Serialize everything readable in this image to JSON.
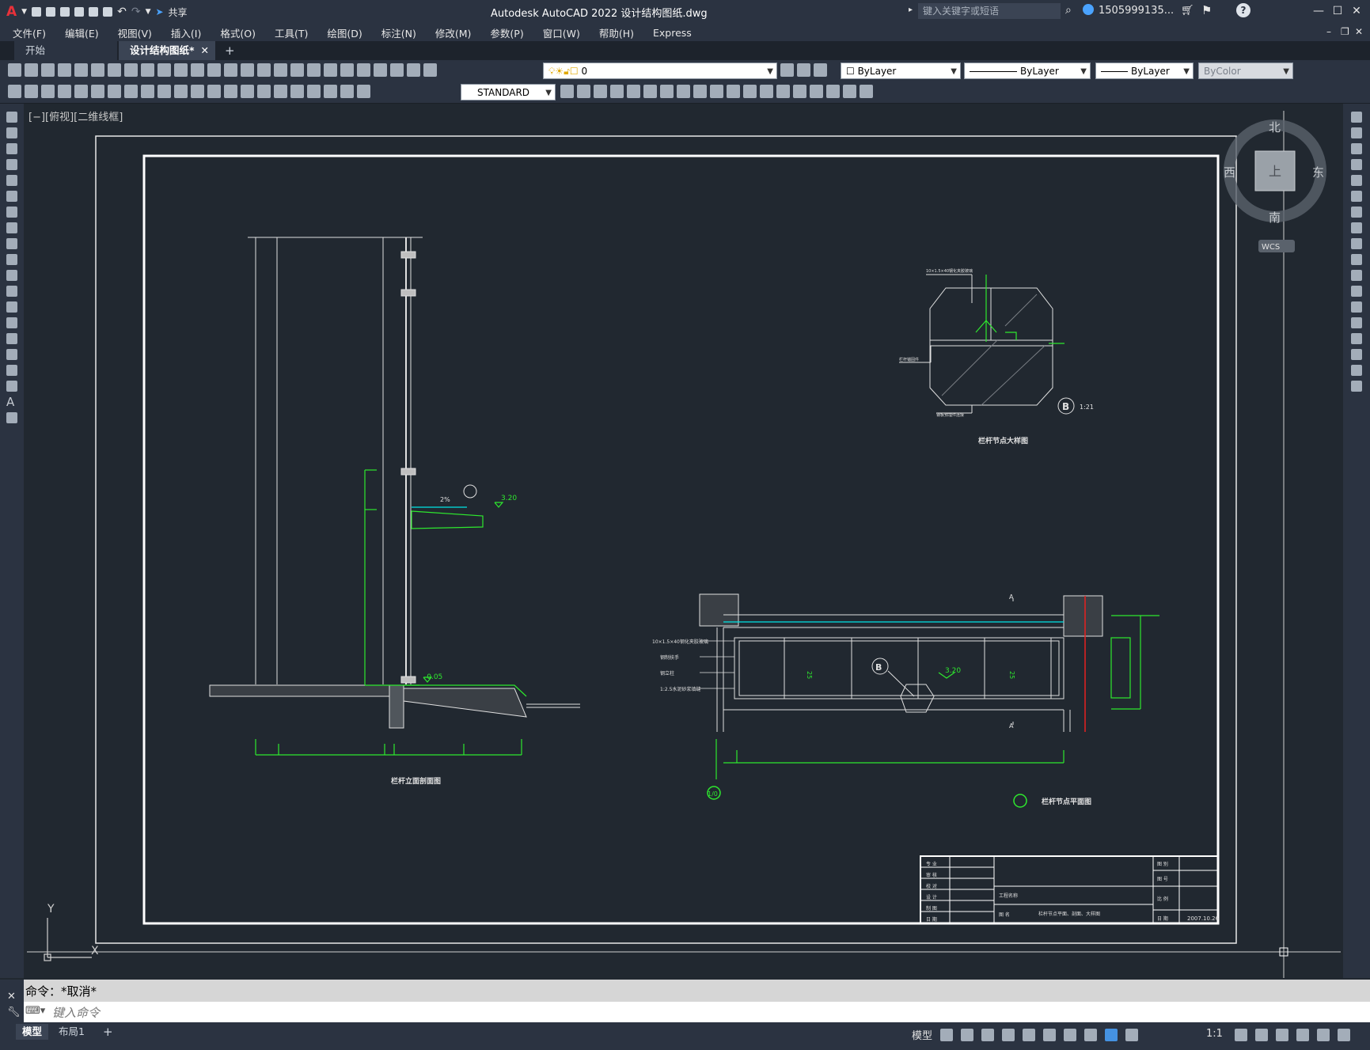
{
  "app": {
    "title": "Autodesk AutoCAD 2022    设计结构图纸.dwg",
    "logo": "A",
    "share": "共享",
    "search_placeholder": "键入关键字或短语",
    "user": "1505999135..."
  },
  "menu": [
    "文件(F)",
    "编辑(E)",
    "视图(V)",
    "插入(I)",
    "格式(O)",
    "工具(T)",
    "绘图(D)",
    "标注(N)",
    "修改(M)",
    "参数(P)",
    "窗口(W)",
    "帮助(H)",
    "Express"
  ],
  "tabs": [
    {
      "label": "开始",
      "active": false
    },
    {
      "label": "设计结构图纸*",
      "active": true,
      "close": "✕"
    }
  ],
  "tab_add": "+",
  "toolbar": {
    "layer_value": "0",
    "color_value": "ByLayer",
    "linetype_value": "ByLayer",
    "lineweight_value": "ByLayer",
    "plotstyle_value": "ByColor",
    "textstyle_value": "STANDARD"
  },
  "viewport": {
    "label": "[−][俯视][二维线框]"
  },
  "viewcube": {
    "north": "北",
    "south": "南",
    "east": "东",
    "west": "西",
    "top": "上",
    "wcs": "WCS"
  },
  "drawing": {
    "elev_320": "3.20",
    "elev_m005": "-0.05",
    "elev_320b": "3.20",
    "slope": "2%",
    "title_section": "栏杆立面剖面图",
    "title_detail": "栏杆节点大样图",
    "title_plan": "栏杆节点平面图",
    "detail_mark": "B",
    "detail_sheet": "1:21",
    "plan_mark": "B",
    "axis_mark": "1/0",
    "label_a1": "A",
    "label_a2": "A",
    "dim_25a": "25",
    "dim_25b": "25",
    "note_1": "10×1.5×40钢化夹胶玻璃",
    "note_2": "钢制扶手",
    "note_3": "钢立柱",
    "note_4": "1:2.5水泥砂浆填缝",
    "note_5": "栏杆锚固件",
    "note_6": "100×60钢板预埋件",
    "note_7": "钢板预埋件连接"
  },
  "titleblock": {
    "left_rows": [
      "专 业",
      "审 核",
      "校 对",
      "设 计",
      "制 图",
      "日 期"
    ],
    "project_label": "工程名称",
    "drawing_label": "图 名",
    "drawing_name": "栏杆节点平面、剖面、大样图",
    "right_rows": [
      "图 别",
      "图 号",
      "比 例",
      "日 期"
    ],
    "date": "2007.10.26"
  },
  "ucs": {
    "y": "Y",
    "x": "X"
  },
  "command": {
    "history": "命令：*取消*",
    "placeholder": "键入命令"
  },
  "layout_tabs": [
    "模型",
    "布局1"
  ],
  "layout_add": "+",
  "status": {
    "model": "模型",
    "scale": "1:1"
  }
}
